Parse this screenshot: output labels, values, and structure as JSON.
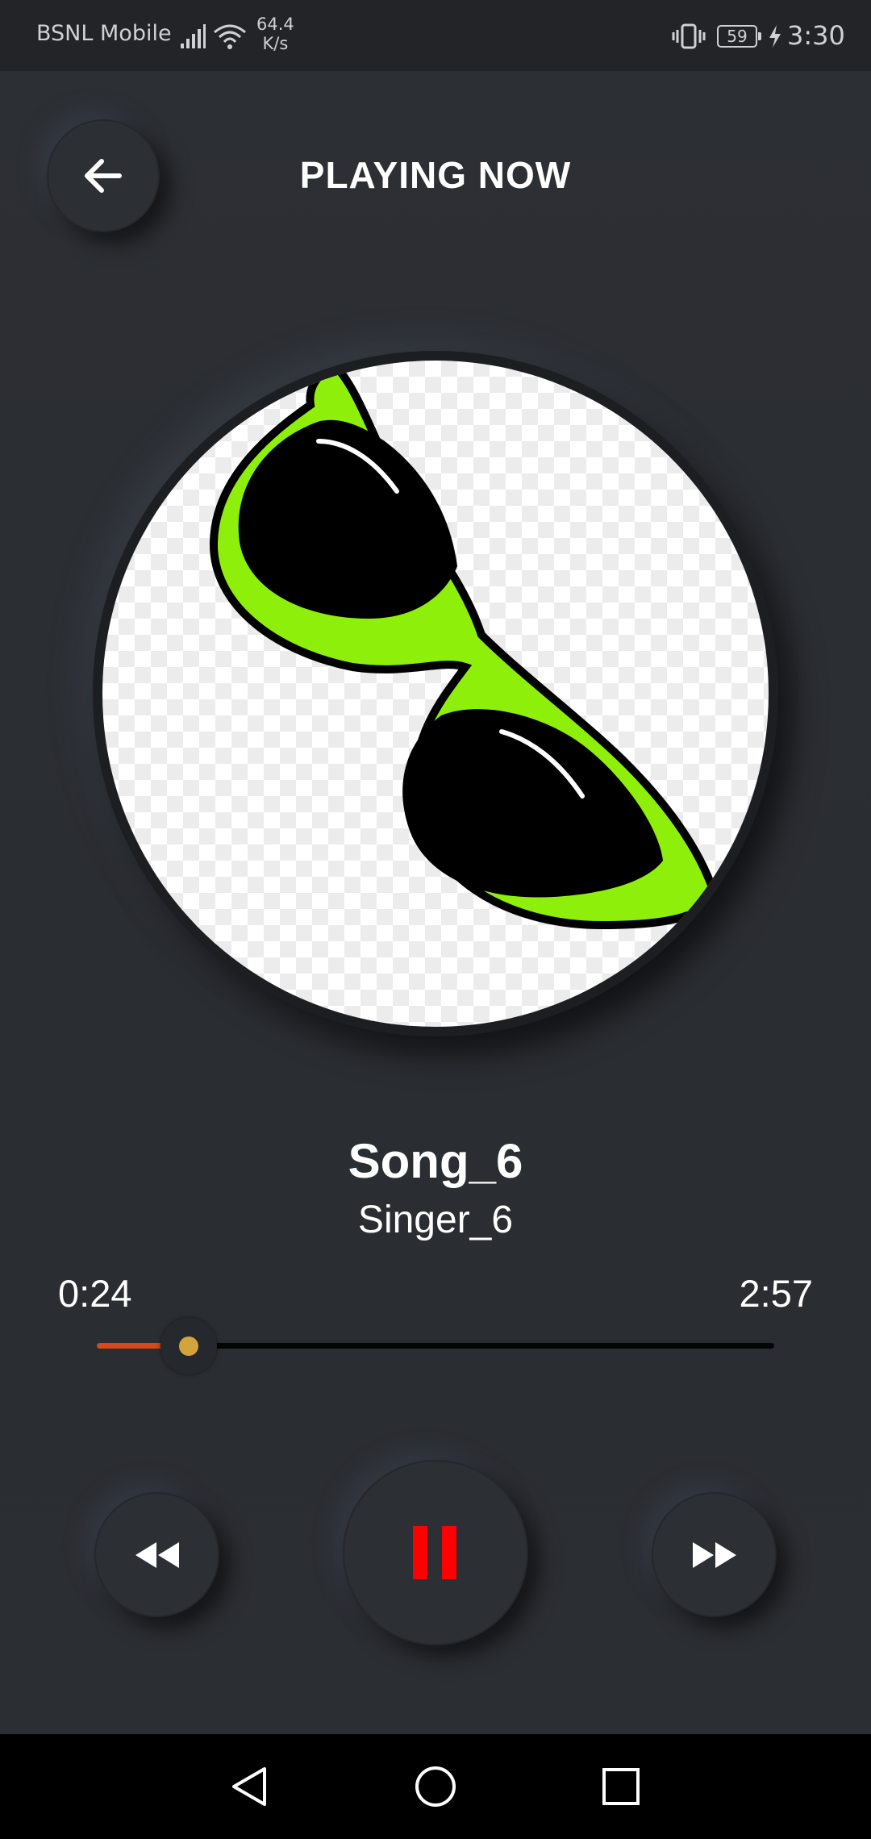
{
  "status_bar": {
    "carrier": "BSNL Mobile",
    "network_speed_value": "64.4",
    "network_speed_unit": "K/s",
    "battery_level": "59",
    "time": "3:30",
    "icons": [
      "signal-icon",
      "wifi-icon",
      "vibrate-icon",
      "battery-icon",
      "charging-icon"
    ]
  },
  "header": {
    "title": "PLAYING NOW",
    "back_icon": "arrow-left-icon"
  },
  "album_art": {
    "description_icon": "sunglasses-icon",
    "frame_color": "#8ef00a"
  },
  "track": {
    "title": "Song_6",
    "artist": "Singer_6",
    "current_time": "0:24",
    "total_time": "2:57",
    "progress": 0.1356
  },
  "controls": {
    "rewind_icon": "rewind-icon",
    "play_pause_icon": "pause-icon",
    "forward_icon": "fast-forward-icon",
    "pause_color": "#ff0000"
  },
  "colors": {
    "background": "#2b2e33",
    "seek_fill": "#d44a1c",
    "seek_thumb": "#d4a43c"
  },
  "nav_bar": {
    "icons": [
      "nav-back-icon",
      "nav-home-icon",
      "nav-recents-icon"
    ]
  }
}
